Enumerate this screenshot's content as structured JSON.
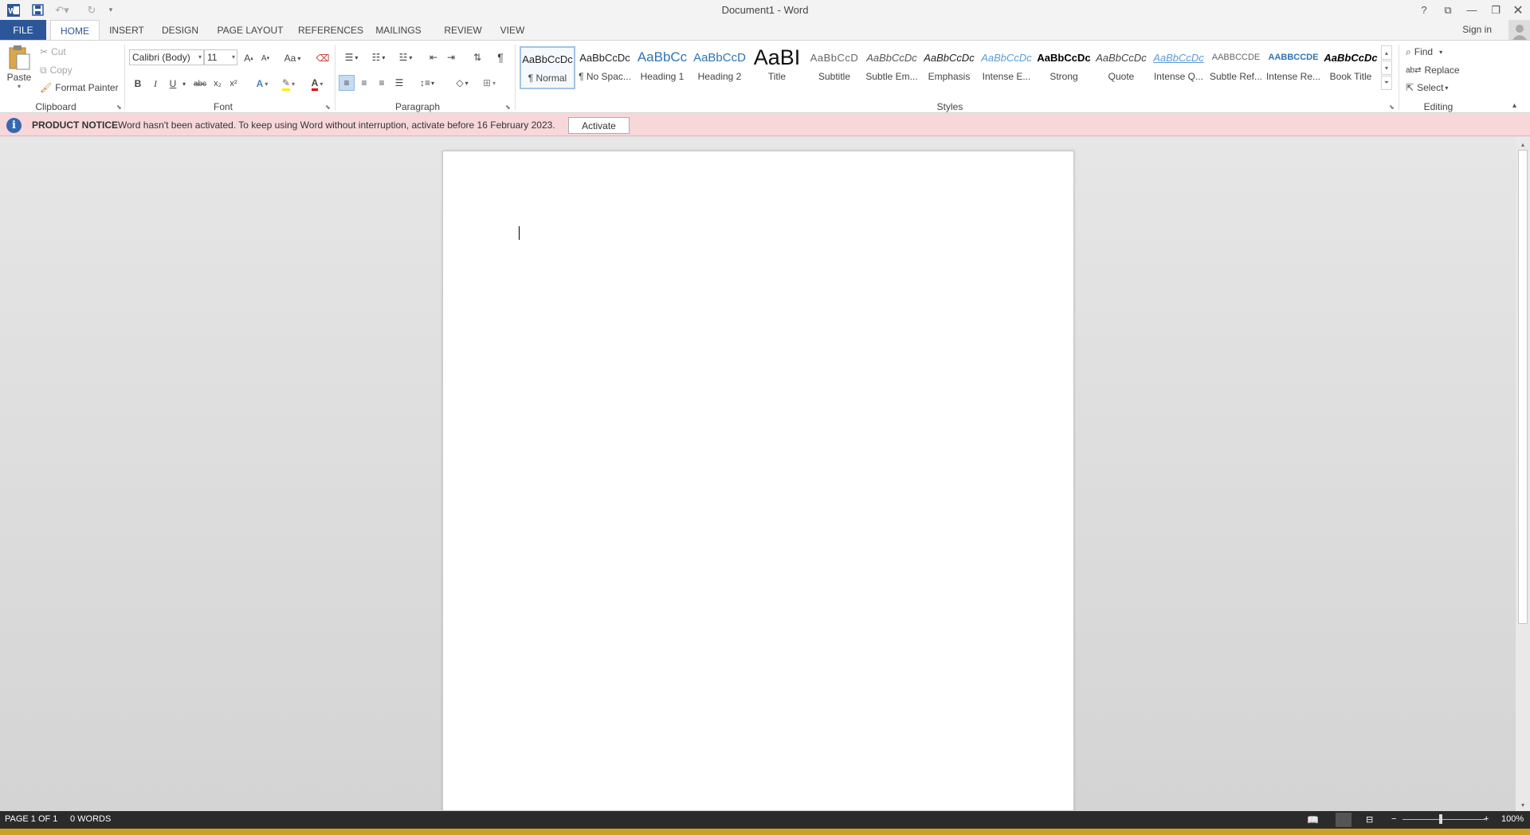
{
  "window": {
    "title": "Document1 - Word",
    "help": "?",
    "sign_in": "Sign in"
  },
  "tabs": [
    {
      "label": "FILE"
    },
    {
      "label": "HOME"
    },
    {
      "label": "INSERT"
    },
    {
      "label": "DESIGN"
    },
    {
      "label": "PAGE LAYOUT"
    },
    {
      "label": "REFERENCES"
    },
    {
      "label": "MAILINGS"
    },
    {
      "label": "REVIEW"
    },
    {
      "label": "VIEW"
    }
  ],
  "clipboard": {
    "paste": "Paste",
    "cut": "Cut",
    "copy": "Copy",
    "format_painter": "Format Painter",
    "group": "Clipboard"
  },
  "font": {
    "name": "Calibri (Body)",
    "size": "11",
    "change_case": "Aa",
    "bold": "B",
    "italic": "I",
    "underline": "U",
    "strike": "abc",
    "sub": "x₂",
    "sup": "x²",
    "text_effects": "A",
    "font_color": "A",
    "grow": "A",
    "shrink": "A",
    "group": "Font"
  },
  "paragraph": {
    "group": "Paragraph",
    "show_marks": "¶"
  },
  "styles": {
    "group": "Styles",
    "items": [
      {
        "preview": "AaBbCcDc",
        "name": "¶ Normal"
      },
      {
        "preview": "AaBbCcDc",
        "name": "¶ No Spac..."
      },
      {
        "preview": "AaBbCc",
        "name": "Heading 1"
      },
      {
        "preview": "AaBbCcD",
        "name": "Heading 2"
      },
      {
        "preview": "AaBI",
        "name": "Title"
      },
      {
        "preview": "AaBbCcD",
        "name": "Subtitle"
      },
      {
        "preview": "AaBbCcDc",
        "name": "Subtle Em..."
      },
      {
        "preview": "AaBbCcDc",
        "name": "Emphasis"
      },
      {
        "preview": "AaBbCcDc",
        "name": "Intense E..."
      },
      {
        "preview": "AaBbCcDc",
        "name": "Strong"
      },
      {
        "preview": "AaBbCcDc",
        "name": "Quote"
      },
      {
        "preview": "AaBbCcDc",
        "name": "Intense Q..."
      },
      {
        "preview": "AABBCCDE",
        "name": "Subtle Ref..."
      },
      {
        "preview": "AABBCCDE",
        "name": "Intense Re..."
      },
      {
        "preview": "AaBbCcDc",
        "name": "Book Title"
      }
    ]
  },
  "editing": {
    "find": "Find",
    "replace": "Replace",
    "select": "Select",
    "group": "Editing"
  },
  "notice": {
    "title": "PRODUCT NOTICE",
    "message": "Word hasn't been activated. To keep using Word without interruption, activate before 16 February 2023.",
    "button": "Activate"
  },
  "status": {
    "page": "PAGE 1 OF 1",
    "words": "0 WORDS",
    "zoom": "100%"
  },
  "colors": {
    "accent": "#2b579a",
    "notice_bg": "#f8d7da",
    "status_bg": "#2b2b2b"
  }
}
